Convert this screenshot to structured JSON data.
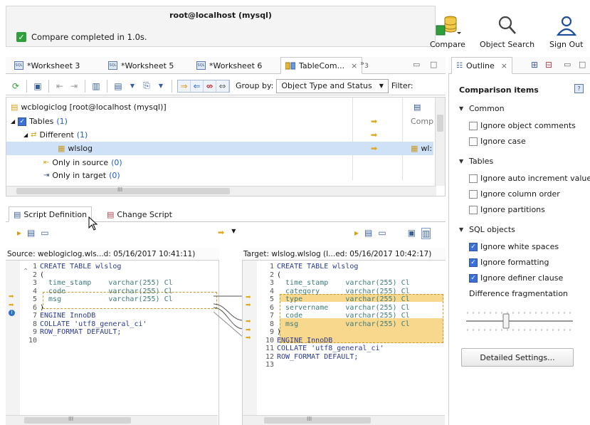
{
  "banner": {
    "title": "root@localhost (mysql)",
    "status": "Compare completed in 1.0s."
  },
  "toolbar_top": {
    "compare": "Compare",
    "object_search": "Object Search",
    "sign_out": "Sign Out"
  },
  "editor_tabs": [
    {
      "label": "*Worksheet 3"
    },
    {
      "label": "*Worksheet 5"
    },
    {
      "label": "*Worksheet 6"
    },
    {
      "label": "TableCom..."
    }
  ],
  "overflow_count": "3",
  "outline_tab": "Outline",
  "compare_toolbar": {
    "group_by_label": "Group by:",
    "group_by_value": "Object Type and Status",
    "filter_label": "Filter:"
  },
  "tree": {
    "root": "wcblogiclog [root@localhost (mysql)]",
    "tables_label": "Tables",
    "tables_count": "(1)",
    "tables_status": "Comp",
    "different_label": "Different",
    "different_count": "(1)",
    "wlslog_label": "wlslog",
    "wlslog_target": "wl:",
    "only_source_label": "Only in source",
    "only_source_count": "(0)",
    "only_target_label": "Only in target",
    "only_target_count": "(0)",
    "scroll_mark": "III"
  },
  "bottom_tabs": {
    "script_definition": "Script Definition",
    "change_script": "Change Script"
  },
  "source": {
    "header": "Source: weblogiclog.wls...d: 05/16/2017 10:41:11)",
    "lines": [
      {
        "n": "1",
        "text": "CREATE TABLE wlslog"
      },
      {
        "n": "2",
        "text": "("
      },
      {
        "n": "3",
        "text": "  time_stamp    varchar(255) Cl"
      },
      {
        "n": "4",
        "text": "  code          varchar(255) Cl"
      },
      {
        "n": "5",
        "text": "  msg           varchar(255) Cl"
      },
      {
        "n": "6",
        "text": ")"
      },
      {
        "n": "7",
        "text": "ENGINE InnoDB"
      },
      {
        "n": "8",
        "text": "COLLATE 'utf8_general_ci'"
      },
      {
        "n": "9",
        "text": "ROW_FORMAT DEFAULT;"
      },
      {
        "n": "10",
        "text": ""
      }
    ],
    "scroll_mark": "III"
  },
  "target": {
    "header": "Target: wlslog.wlslog (I...ed: 05/16/2017 10:42:17)",
    "lines": [
      {
        "n": "1",
        "text": "CREATE TABLE wlslog"
      },
      {
        "n": "2",
        "text": "("
      },
      {
        "n": "3",
        "text": "  time_stamp    varchar(255) Cl"
      },
      {
        "n": "4",
        "text": "  category      varchar(255) Cl"
      },
      {
        "n": "5",
        "text": "  type          varchar(255) Cl"
      },
      {
        "n": "6",
        "text": "  servername    varchar(255) Cl"
      },
      {
        "n": "7",
        "text": "  code          varchar(255) Cl"
      },
      {
        "n": "8",
        "text": "  msg           varchar(255) Cl"
      },
      {
        "n": "9",
        "text": ")"
      },
      {
        "n": "10",
        "text": "ENGINE InnoDB"
      },
      {
        "n": "11",
        "text": "COLLATE 'utf8_general_ci'"
      },
      {
        "n": "12",
        "text": "ROW_FORMAT DEFAULT;"
      },
      {
        "n": "13",
        "text": ""
      }
    ],
    "scroll_mark": "III"
  },
  "outline": {
    "title": "Comparison items",
    "common": "Common",
    "ignore_object_comments": "Ignore object comments",
    "ignore_case": "Ignore case",
    "tables": "Tables",
    "ignore_auto_increment": "Ignore auto increment value",
    "ignore_column_order": "Ignore column order",
    "ignore_partitions": "Ignore partitions",
    "sql_objects": "SQL objects",
    "ignore_white_spaces": "Ignore white spaces",
    "ignore_formatting": "Ignore formatting",
    "ignore_definer": "Ignore definer clause",
    "difference_fragmentation": "Difference fragmentation",
    "detailed_settings": "Detailed Settings..."
  },
  "colors": {
    "accent": "#3b6fd6",
    "diff_highlight": "#f7d88c",
    "selection": "#cfe1f7",
    "success": "#2f9f3c"
  }
}
